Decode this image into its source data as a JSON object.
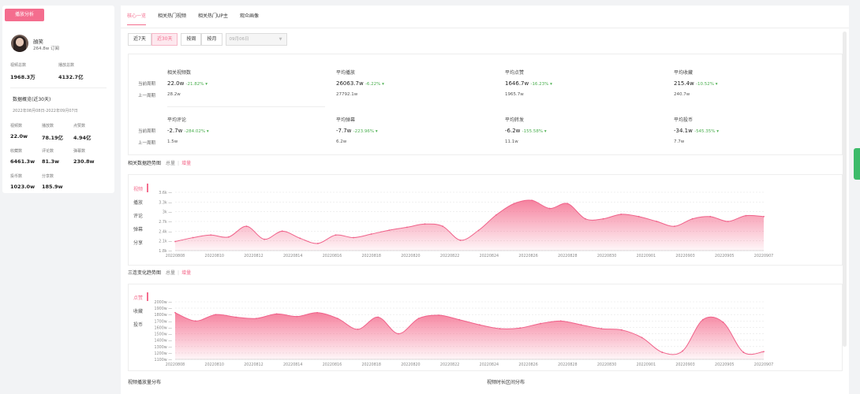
{
  "sidebar": {
    "tag": "播放分析",
    "user": {
      "name": "顔笑",
      "subs": "264.8w 订阅"
    },
    "totals": [
      {
        "label": "视频总数",
        "value": "1968.3万"
      },
      {
        "label": "播放总数",
        "value": "4132.7亿"
      }
    ],
    "overview_title": "数据概览(近30天)",
    "overview_range": "2022年08月08日-2022年09月07日",
    "metrics": [
      {
        "label": "视频数",
        "value": "22.0w"
      },
      {
        "label": "播放数",
        "value": "78.19亿"
      },
      {
        "label": "点赞数",
        "value": "4.94亿"
      },
      {
        "label": "收藏数",
        "value": "6461.3w"
      },
      {
        "label": "评论数",
        "value": "81.3w"
      },
      {
        "label": "弹幕数",
        "value": "230.8w"
      },
      {
        "label": "投币数",
        "value": "1023.0w"
      },
      {
        "label": "分享数",
        "value": "185.9w"
      }
    ]
  },
  "tabs": [
    "核心一览",
    "相关热门视频",
    "相关热门UP主",
    "观众画像"
  ],
  "filters": {
    "range": [
      "近7天",
      "近30天"
    ],
    "period": [
      "按周",
      "按月"
    ],
    "date": "09月06日"
  },
  "stats": {
    "row_labels": [
      "当前周期",
      "上一周期"
    ],
    "groups": [
      {
        "title": "相关视频数",
        "value": "22.0w",
        "pct": "-21.82% ▾",
        "prev": "28.2w"
      },
      {
        "title": "平均播放",
        "value": "26063.7w",
        "pct": "-6.22% ▾",
        "prev": "27792.1w"
      },
      {
        "title": "平均点赞",
        "value": "1646.7w",
        "pct": "-16.23% ▾",
        "prev": "1965.7w"
      },
      {
        "title": "平均收藏",
        "value": "215.4w",
        "pct": "-10.52% ▾",
        "prev": "240.7w"
      },
      {
        "title": "平均评论",
        "value": "-2.7w",
        "pct": "-284.02% ▾",
        "prev": "1.5w"
      },
      {
        "title": "平均弹幕",
        "value": "-7.7w",
        "pct": "-223.96% ▾",
        "prev": "6.2w"
      },
      {
        "title": "平均转发",
        "value": "-6.2w",
        "pct": "-155.58% ▾",
        "prev": "11.1w"
      },
      {
        "title": "平均投币",
        "value": "-34.1w",
        "pct": "-545.35% ▾",
        "prev": "7.7w"
      }
    ]
  },
  "trend1": {
    "title": "相关数据趋势图",
    "opt_total": "总量",
    "opt_inc": "增量",
    "metrics": [
      "视频",
      "播放",
      "评论",
      "弹幕",
      "分享"
    ]
  },
  "trend2": {
    "title": "三连变化趋势图",
    "opt_total": "总量",
    "opt_inc": "增量",
    "metrics": [
      "点赞",
      "收藏",
      "投币"
    ]
  },
  "bottom": {
    "left": "视频播放量分布",
    "right": "视频时长区间分布"
  },
  "colors": {
    "accent": "#f46d8e",
    "down": "#4caf50"
  },
  "chart_data": [
    {
      "type": "area",
      "ylim": [
        1.8,
        3.6
      ],
      "y_ticks": [
        "3.6k",
        "3.3k",
        "3k",
        "2.7k",
        "2.4k",
        "2.1k",
        "1.8k"
      ],
      "x_ticks": [
        "20220808",
        "20220810",
        "20220812",
        "20220814",
        "20220816",
        "20220818",
        "20220820",
        "20220822",
        "20220824",
        "20220826",
        "20220828",
        "20220830",
        "20220901",
        "20220903",
        "20220905",
        "20220907"
      ],
      "series": [
        {
          "values": [
            2.08,
            2.2,
            2.28,
            2.22,
            2.55,
            2.15,
            2.4,
            2.18,
            2.02,
            2.28,
            2.2,
            2.31,
            2.43,
            2.52,
            2.62,
            2.55,
            2.12,
            2.42,
            2.9,
            3.25,
            3.35,
            3.1,
            3.25,
            2.78,
            2.78,
            2.92,
            2.85,
            2.7,
            2.55,
            2.78,
            2.85,
            2.7,
            2.88,
            2.85
          ]
        }
      ]
    },
    {
      "type": "area",
      "ylim": [
        1100,
        2000
      ],
      "y_ticks": [
        "2000w",
        "1900w",
        "1800w",
        "1700w",
        "1600w",
        "1500w",
        "1400w",
        "1300w",
        "1200w",
        "1100w"
      ],
      "x_ticks": [
        "20220808",
        "20220810",
        "20220812",
        "20220814",
        "20220816",
        "20220818",
        "20220820",
        "20220822",
        "20220824",
        "20220826",
        "20220828",
        "20220830",
        "20220901",
        "20220903",
        "20220905",
        "20220907"
      ],
      "series": [
        {
          "values": [
            1830,
            1700,
            1800,
            1760,
            1740,
            1810,
            1770,
            1830,
            1740,
            1570,
            1760,
            1500,
            1740,
            1790,
            1720,
            1640,
            1580,
            1590,
            1660,
            1700,
            1640,
            1580,
            1560,
            1440,
            1210,
            1230,
            1720,
            1680,
            1210,
            1220
          ]
        }
      ]
    }
  ]
}
